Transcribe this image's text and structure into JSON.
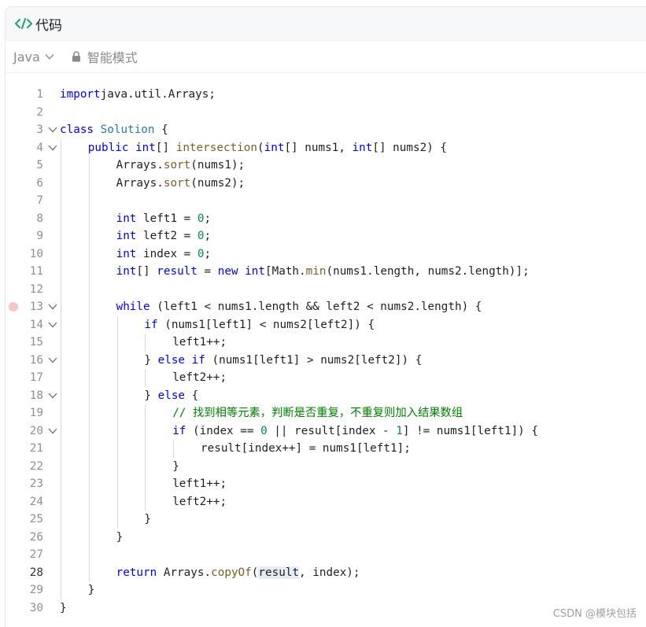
{
  "header": {
    "title": "代码",
    "icon": "code-icon"
  },
  "toolbar": {
    "language": "Java",
    "mode": "智能模式"
  },
  "editor": {
    "lines": [
      {
        "n": "1",
        "indent": 0,
        "tokens": [
          [
            "kw",
            "import"
          ],
          [
            "",
            "java.util.Arrays;"
          ]
        ]
      },
      {
        "n": "2",
        "indent": 0,
        "tokens": []
      },
      {
        "n": "3",
        "indent": 0,
        "fold": true,
        "tokens": [
          [
            "kw",
            "class"
          ],
          [
            "",
            " "
          ],
          [
            "ty",
            "Solution"
          ],
          [
            "",
            " {"
          ]
        ]
      },
      {
        "n": "4",
        "indent": 1,
        "fold": true,
        "tokens": [
          [
            "kw",
            "public"
          ],
          [
            "",
            " "
          ],
          [
            "kw",
            "int"
          ],
          [
            "",
            "[] "
          ],
          [
            "fn",
            "intersection"
          ],
          [
            "",
            "("
          ],
          [
            "kw",
            "int"
          ],
          [
            "",
            "[] nums1, "
          ],
          [
            "kw",
            "int"
          ],
          [
            "",
            "[] nums2) {"
          ]
        ]
      },
      {
        "n": "5",
        "indent": 2,
        "tokens": [
          [
            "",
            "Arrays."
          ],
          [
            "fn",
            "sort"
          ],
          [
            "",
            "(nums1);"
          ]
        ]
      },
      {
        "n": "6",
        "indent": 2,
        "tokens": [
          [
            "",
            "Arrays."
          ],
          [
            "fn",
            "sort"
          ],
          [
            "",
            "(nums2);"
          ]
        ]
      },
      {
        "n": "7",
        "indent": 0,
        "tokens": []
      },
      {
        "n": "8",
        "indent": 2,
        "tokens": [
          [
            "kw",
            "int"
          ],
          [
            "",
            " left1 = "
          ],
          [
            "nm",
            "0"
          ],
          [
            "",
            ";"
          ]
        ]
      },
      {
        "n": "9",
        "indent": 2,
        "tokens": [
          [
            "kw",
            "int"
          ],
          [
            "",
            " left2 = "
          ],
          [
            "nm",
            "0"
          ],
          [
            "",
            ";"
          ]
        ]
      },
      {
        "n": "10",
        "indent": 2,
        "tokens": [
          [
            "kw",
            "int"
          ],
          [
            "",
            " index = "
          ],
          [
            "nm",
            "0"
          ],
          [
            "",
            ";"
          ]
        ]
      },
      {
        "n": "11",
        "indent": 2,
        "tokens": [
          [
            "kw",
            "int"
          ],
          [
            "",
            "[] "
          ],
          [
            "kw",
            "result"
          ],
          [
            "",
            " = "
          ],
          [
            "kw",
            "new"
          ],
          [
            "",
            " "
          ],
          [
            "kw",
            "int"
          ],
          [
            "",
            "[Math."
          ],
          [
            "fn",
            "min"
          ],
          [
            "",
            "(nums1.length, nums2.length)];"
          ]
        ]
      },
      {
        "n": "12",
        "indent": 0,
        "tokens": []
      },
      {
        "n": "13",
        "indent": 2,
        "fold": true,
        "breakpoint": true,
        "tokens": [
          [
            "kw",
            "while"
          ],
          [
            "",
            " (left1 < nums1.length && left2 < nums2.length) {"
          ]
        ]
      },
      {
        "n": "14",
        "indent": 3,
        "fold": true,
        "tokens": [
          [
            "kw",
            "if"
          ],
          [
            "",
            " (nums1[left1] < nums2[left2]) {"
          ]
        ]
      },
      {
        "n": "15",
        "indent": 4,
        "tokens": [
          [
            "",
            "left1++;"
          ]
        ]
      },
      {
        "n": "16",
        "indent": 3,
        "fold": true,
        "tokens": [
          [
            "",
            "} "
          ],
          [
            "kw",
            "else if"
          ],
          [
            "",
            " (nums1[left1] > nums2[left2]) {"
          ]
        ]
      },
      {
        "n": "17",
        "indent": 4,
        "tokens": [
          [
            "",
            "left2++;"
          ]
        ]
      },
      {
        "n": "18",
        "indent": 3,
        "fold": true,
        "tokens": [
          [
            "",
            "} "
          ],
          [
            "kw",
            "else"
          ],
          [
            "",
            " {"
          ]
        ]
      },
      {
        "n": "19",
        "indent": 4,
        "tokens": [
          [
            "cm",
            "// 找到相等元素，判断是否重复，不重复则加入结果数组"
          ]
        ]
      },
      {
        "n": "20",
        "indent": 4,
        "fold": true,
        "tokens": [
          [
            "kw",
            "if"
          ],
          [
            "",
            " (index == "
          ],
          [
            "nm",
            "0"
          ],
          [
            "",
            " || result[index - "
          ],
          [
            "nm",
            "1"
          ],
          [
            "",
            "] != nums1[left1]) {"
          ]
        ]
      },
      {
        "n": "21",
        "indent": 5,
        "tokens": [
          [
            "",
            "result[index++] = nums1[left1];"
          ]
        ]
      },
      {
        "n": "22",
        "indent": 4,
        "tokens": [
          [
            "",
            "}"
          ]
        ]
      },
      {
        "n": "23",
        "indent": 4,
        "tokens": [
          [
            "",
            "left1++;"
          ]
        ]
      },
      {
        "n": "24",
        "indent": 4,
        "tokens": [
          [
            "",
            "left2++;"
          ]
        ]
      },
      {
        "n": "25",
        "indent": 3,
        "tokens": [
          [
            "",
            "}"
          ]
        ]
      },
      {
        "n": "26",
        "indent": 2,
        "tokens": [
          [
            "",
            "}"
          ]
        ]
      },
      {
        "n": "27",
        "indent": 0,
        "tokens": []
      },
      {
        "n": "28",
        "indent": 2,
        "active": true,
        "tokens": [
          [
            "kw",
            "return"
          ],
          [
            "",
            " Arrays."
          ],
          [
            "fn",
            "copyOf"
          ],
          [
            "",
            "("
          ],
          [
            "hl",
            "result"
          ],
          [
            "",
            ", index);"
          ]
        ]
      },
      {
        "n": "29",
        "indent": 1,
        "tokens": [
          [
            "",
            "}"
          ]
        ]
      },
      {
        "n": "30",
        "indent": 0,
        "tokens": [
          [
            "",
            "}"
          ]
        ]
      }
    ]
  },
  "watermark": "CSDN @模块包括"
}
